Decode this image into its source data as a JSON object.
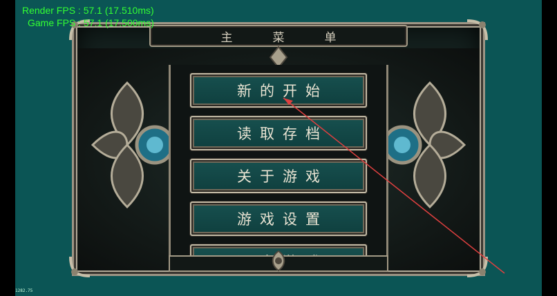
{
  "overlay": {
    "render_fps": "Render FPS : 57.1 (17.510ms)",
    "game_fps": "Game FPS : 57.1 (17.500ms)"
  },
  "menu": {
    "title": "主菜单",
    "items": [
      {
        "label": "新的开始"
      },
      {
        "label": "读取存档"
      },
      {
        "label": "关于游戏"
      },
      {
        "label": "游戏设置"
      },
      {
        "label": "退出游戏"
      }
    ]
  },
  "footer": {
    "tiny_text": "1282.75"
  },
  "colors": {
    "background": "#0b5555",
    "button_fill": "#17504f",
    "frame_metal": "#a39a86",
    "fps_text": "#33ff33",
    "pointer_line": "#e04040"
  }
}
